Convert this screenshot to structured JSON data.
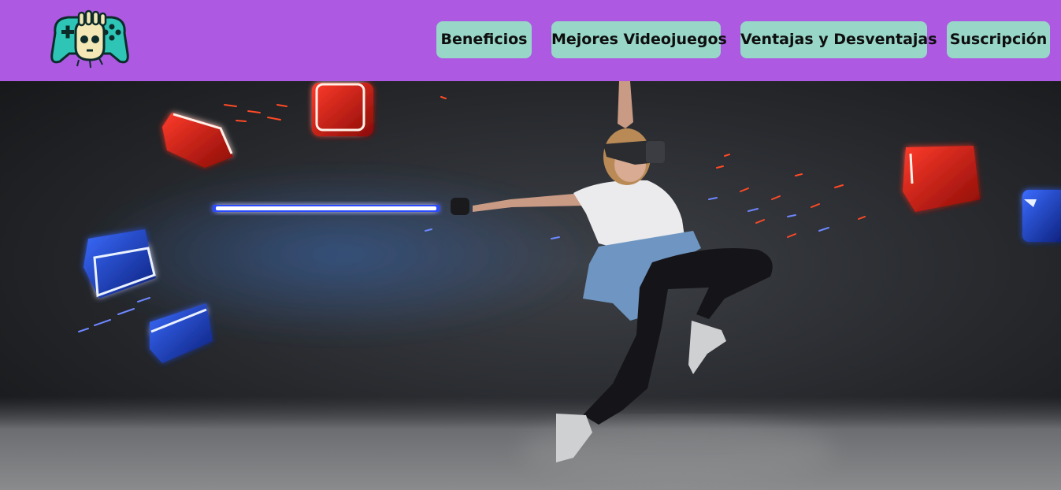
{
  "header": {
    "background_color": "#ad59e2",
    "logo_icon": "gamepad-skull-logo-icon",
    "nav": [
      {
        "label": "Beneficios"
      },
      {
        "label": "Mejores Videojuegos"
      },
      {
        "label": "Ventajas y Desventajas"
      },
      {
        "label": "Suscripción"
      }
    ],
    "nav_button_color": "#98d6c8"
  },
  "hero": {
    "image_subject": "vr-dancer-image",
    "cube_colors": {
      "red": "#c4150f",
      "blue": "#1f3fc2"
    }
  }
}
